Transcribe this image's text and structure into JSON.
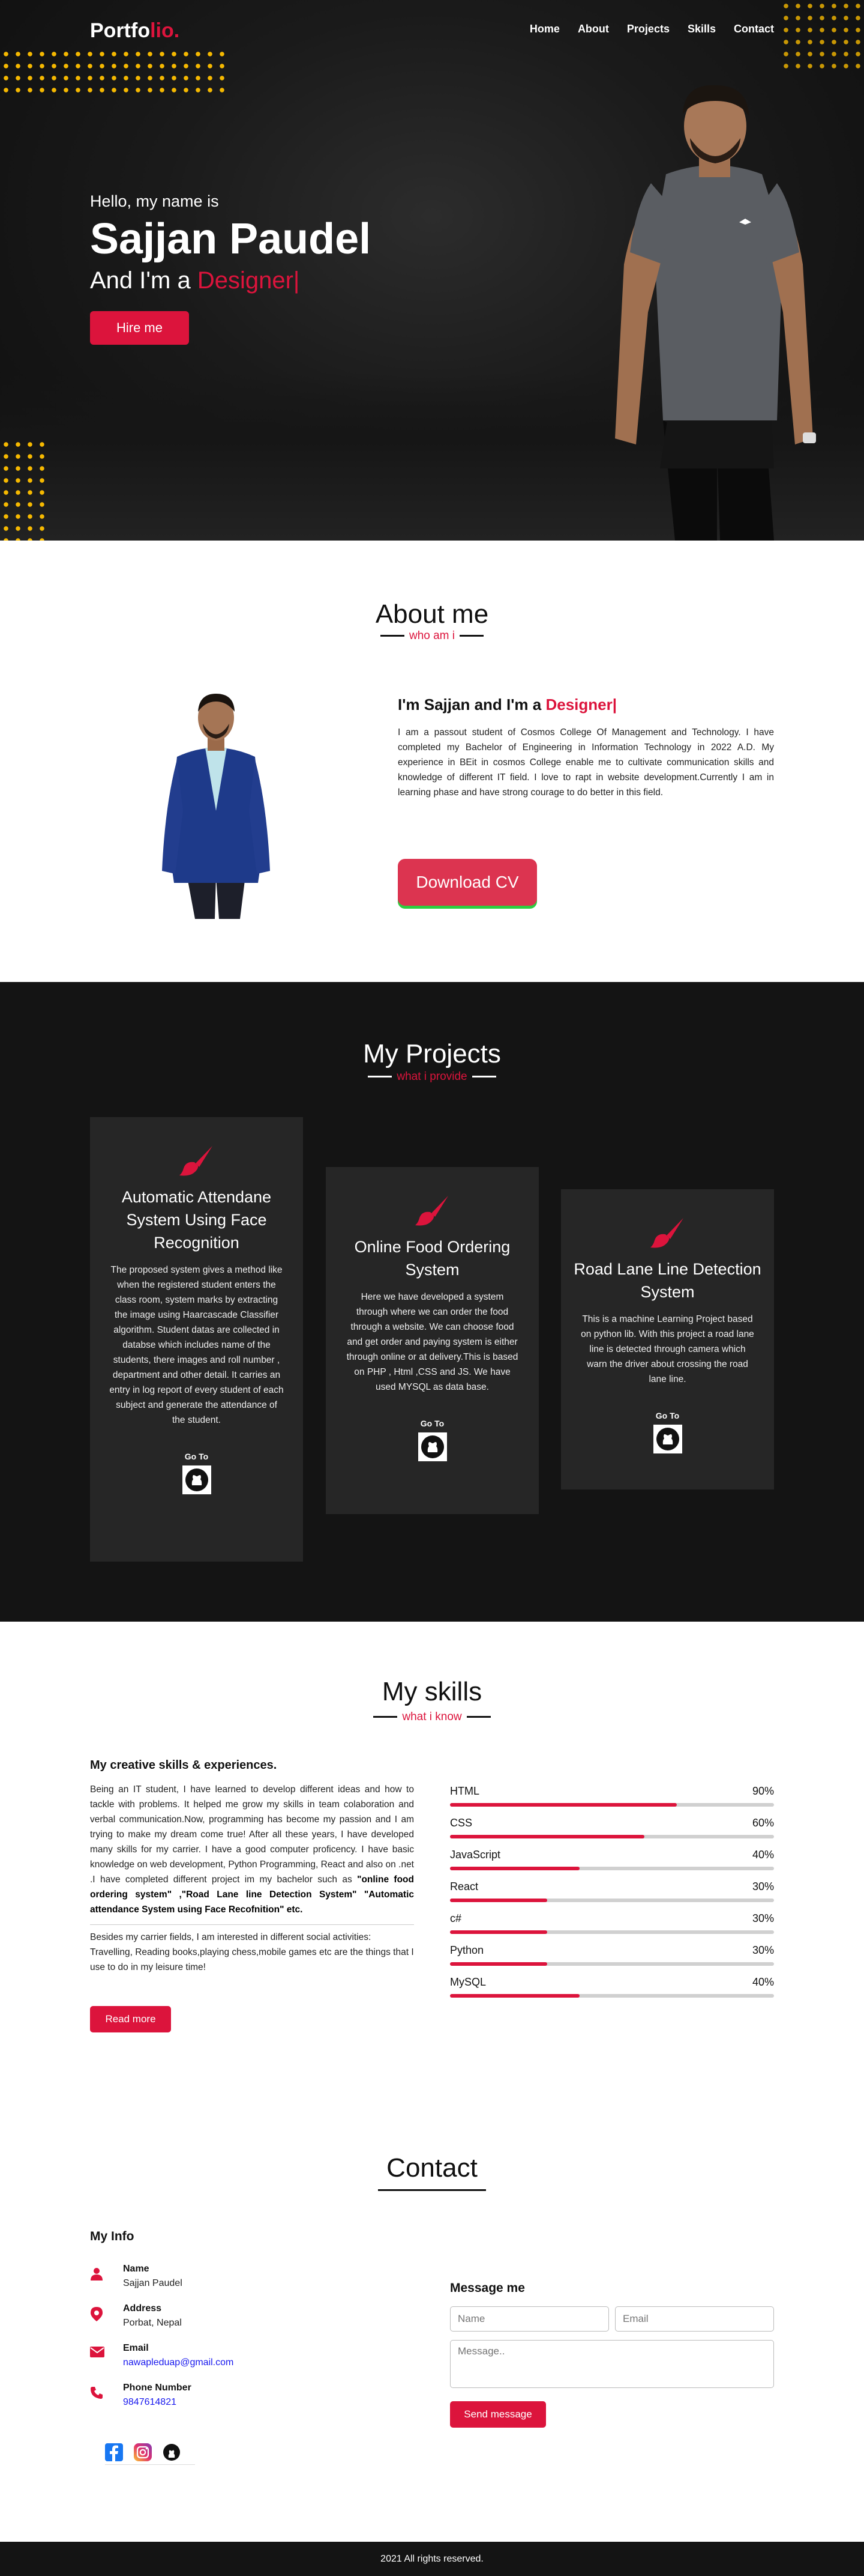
{
  "nav": {
    "logo_main": "Portfo",
    "logo_accent": "lio.",
    "items": [
      {
        "label": "Home"
      },
      {
        "label": "About"
      },
      {
        "label": "Projects"
      },
      {
        "label": "Skills"
      },
      {
        "label": "Contact"
      }
    ]
  },
  "hero": {
    "greeting": "Hello, my name is",
    "name": "Sajjan Paudel",
    "role_prefix": "And I'm a ",
    "role_accent": "Designer|",
    "hire_label": "Hire me"
  },
  "about": {
    "title": "About me",
    "subtitle": "who am i",
    "heading_prefix": "I'm Sajjan and I'm a ",
    "heading_accent": "Designer|",
    "paragraph": "I am a passout student of Cosmos College Of Management and Technology. I have completed my Bachelor of Engineering in Information Technology in 2022 A.D. My experience in BEit in cosmos College enable me to cultivate communication skills and knowledge of different IT field. I love to rapt in website development.Currently I am in learning phase and have strong courage to do better in this field.",
    "cv_label": "Download CV"
  },
  "projects": {
    "title": "My Projects",
    "subtitle": "what i provide",
    "cards": [
      {
        "title": "Automatic Attendane System Using Face Recognition",
        "description": "The proposed system gives a method like when the registered student enters the class room, system marks by extracting the image using Haarcascade Classifier algorithm. Student datas are collected in databse which includes name of the students, there images and roll number , department and other detail. It carries an entry in log report of every student of each subject and generate the attendance of the student.",
        "goto_label": "Go To"
      },
      {
        "title": "Online Food Ordering System",
        "description": "Here we have developed a system through where we can order the food through a website. We can choose food and get order and paying system is either through online or at delivery.This is based on PHP , Html ,CSS and JS. We have used MYSQL as data base.",
        "goto_label": "Go To"
      },
      {
        "title": "Road Lane Line Detection System",
        "description": "This is a machine Learning Project based on python lib. With this project a road lane line is detected through camera which warn the driver about crossing the road lane line.",
        "goto_label": "Go To"
      }
    ]
  },
  "skills": {
    "title": "My skills",
    "subtitle": "what i know",
    "heading": "My creative skills & experiences.",
    "paragraph_start": "Being an IT student, I have learned to develop different ideas and how to tackle with problems. It helped me grow my skills in team colaboration and verbal communication.Now, programming has become my passion and I am trying to make my dream come true! After all these years, I have developed many skills for my carrier. I have a good computer proficency. I have basic knowledge on web development, Python Programming, React and also on .net .I have completed different project im my bachelor such as ",
    "paragraph_bold": "\"online food ordering system\" ,\"Road Lane line Detection System\" \"Automatic attendance System using Face Recofnition\" etc.",
    "paragraph2": "Besides my carrier fields, I am interested in different social activities: Travelling, Reading books,playing chess,mobile games etc are the things that I use to do in my leisure time!",
    "more_label": "Read more",
    "list": [
      {
        "name": "HTML",
        "percent": "90%",
        "level": 0.7
      },
      {
        "name": "CSS",
        "percent": "60%",
        "level": 0.6
      },
      {
        "name": "JavaScript",
        "percent": "40%",
        "level": 0.4
      },
      {
        "name": "React",
        "percent": "30%",
        "level": 0.3
      },
      {
        "name": "c#",
        "percent": "30%",
        "level": 0.3
      },
      {
        "name": "Python",
        "percent": "30%",
        "level": 0.3
      },
      {
        "name": "MySQL",
        "percent": "40%",
        "level": 0.4
      }
    ]
  },
  "contact": {
    "title": "Contact",
    "info_heading": "My Info",
    "items": [
      {
        "label": "Name",
        "value": "Sajjan Paudel",
        "icon": "user-icon"
      },
      {
        "label": "Address",
        "value": "Porbat, Nepal",
        "icon": "location-pin-icon"
      },
      {
        "label": "Email",
        "value": "nawapleduap@gmail.com",
        "icon": "envelope-icon"
      },
      {
        "label": "Phone Number",
        "value": "9847614821",
        "icon": "phone-icon"
      }
    ],
    "message_heading": "Message me",
    "name_placeholder": "Name",
    "email_placeholder": "Email",
    "message_placeholder": "Message..",
    "send_label": "Send message"
  },
  "footer": {
    "text": "2021 All rights reserved."
  },
  "colors": {
    "accent": "#dc143c",
    "dark_bg": "#141414",
    "card_bg": "#262626",
    "dots": "#f5b800"
  }
}
